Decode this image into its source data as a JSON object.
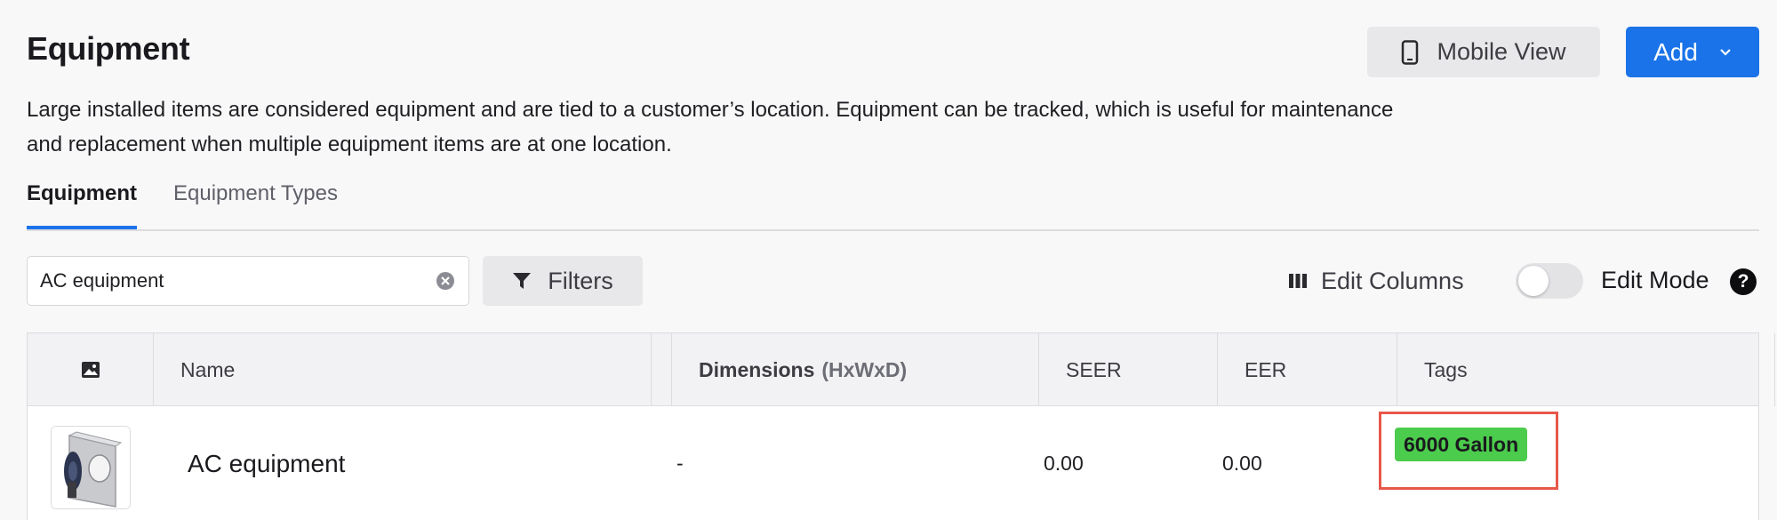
{
  "header": {
    "title": "Equipment",
    "description": "Large installed items are considered equipment and are tied to a customer’s location. Equipment can be tracked, which is useful for maintenance and replacement when multiple equipment items are at one location.",
    "mobile_view_label": "Mobile View",
    "add_label": "Add"
  },
  "tabs": [
    {
      "label": "Equipment",
      "active": true
    },
    {
      "label": "Equipment Types",
      "active": false
    }
  ],
  "toolbar": {
    "search_value": "AC equipment",
    "filters_label": "Filters",
    "edit_columns_label": "Edit Columns",
    "edit_mode_label": "Edit Mode",
    "edit_mode_on": false,
    "help_label": "?"
  },
  "table": {
    "columns": {
      "image": "image-icon",
      "name": "Name",
      "dimensions": "Dimensions",
      "dimensions_unit": "(HxWxD)",
      "seer": "SEER",
      "eer": "EER",
      "tags": "Tags"
    },
    "rows": [
      {
        "name": "AC equipment",
        "dimensions": "-",
        "seer": "0.00",
        "eer": "0.00",
        "tags": [
          "6000 Gallon"
        ]
      }
    ]
  },
  "colors": {
    "primary": "#1a73e8",
    "tag_green": "#4ccc4c",
    "highlight_red": "#e8584a"
  }
}
